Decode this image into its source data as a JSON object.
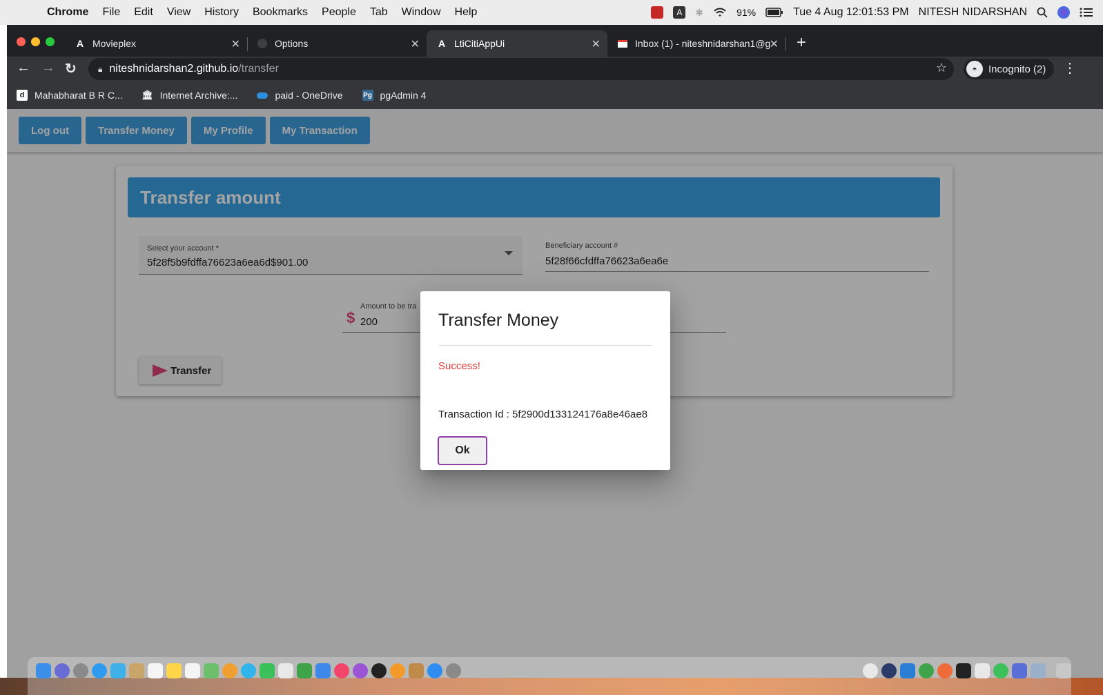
{
  "menubar": {
    "app": "Chrome",
    "items": [
      "File",
      "Edit",
      "View",
      "History",
      "Bookmarks",
      "People",
      "Tab",
      "Window",
      "Help"
    ],
    "battery": "91%",
    "clock": "Tue 4 Aug  12:01:53 PM",
    "user": "NITESH NIDARSHAN"
  },
  "tabs": [
    {
      "title": "Movieplex",
      "icon": "angular-icon"
    },
    {
      "title": "Options",
      "icon": "github-icon"
    },
    {
      "title": "LtiCitiAppUi",
      "icon": "angular-icon",
      "active": true
    },
    {
      "title": "Inbox (1) - niteshnidarshan1@g",
      "icon": "gmail-icon"
    }
  ],
  "address": {
    "host": "niteshnidarshan2.github.io",
    "path": "/transfer"
  },
  "incognito_label": "Incognito (2)",
  "bookmarks": [
    {
      "label": "Mahabharat B R C...",
      "icon": "d-icon"
    },
    {
      "label": "Internet Archive:...",
      "icon": "archive-icon"
    },
    {
      "label": "paid - OneDrive",
      "icon": "onedrive-icon"
    },
    {
      "label": "pgAdmin 4",
      "icon": "pgadmin-icon"
    }
  ],
  "appnav": {
    "logout": "Log out",
    "transfer": "Transfer Money",
    "profile": "My Profile",
    "transactions": "My Transaction"
  },
  "form": {
    "title": "Transfer amount",
    "account_label": "Select your account *",
    "account_value": "5f28f5b9fdffa76623a6ea6d$901.00",
    "beneficiary_label": "Beneficiary account #",
    "beneficiary_value": "5f28f66cfdffa76623a6ea6e",
    "amount_label": "Amount to be tra",
    "amount_value": "200",
    "currency_symbol": "$",
    "transfer_button": "Transfer"
  },
  "dialog": {
    "title": "Transfer Money",
    "status": "Success!",
    "transaction": "Transaction Id : 5f2900d133124176a8e46ae8",
    "ok_button": "Ok"
  },
  "colors": {
    "primary": "#3aa3e8",
    "accent": "#e0457b",
    "success_text": "#e53935",
    "ok_border": "#8e3ca8"
  }
}
